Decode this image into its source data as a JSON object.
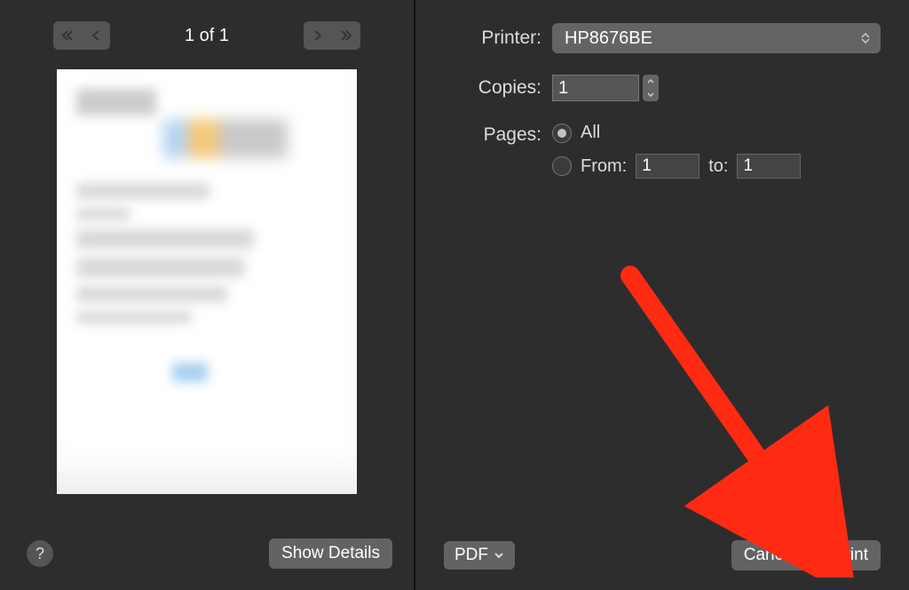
{
  "preview": {
    "page_indicator": "1 of 1"
  },
  "left_footer": {
    "help_label": "?",
    "show_details_label": "Show Details"
  },
  "form": {
    "printer_label": "Printer:",
    "printer_value": "HP8676BE",
    "copies_label": "Copies:",
    "copies_value": "1",
    "pages_label": "Pages:",
    "pages_all_label": "All",
    "pages_from_label": "From:",
    "pages_from_value": "1",
    "pages_to_label": "to:",
    "pages_to_value": "1"
  },
  "footer": {
    "pdf_label": "PDF",
    "cancel_label": "Cancel",
    "print_label": "Print"
  },
  "annotation": {
    "arrow_color": "#ff2a12"
  }
}
